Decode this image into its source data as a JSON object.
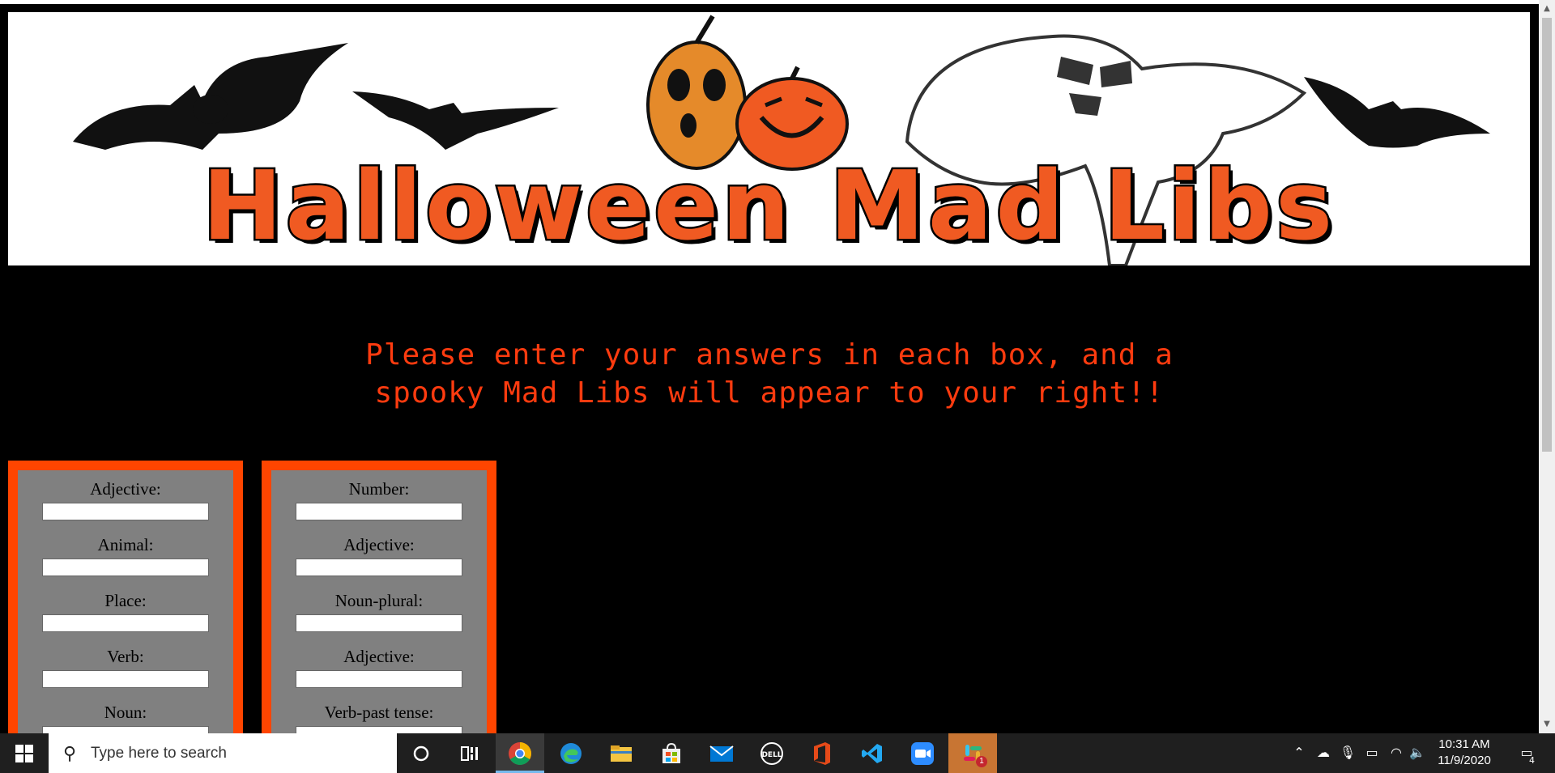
{
  "banner": {
    "title": "Halloween Mad Libs",
    "colors": {
      "title_fill": "#f05a22",
      "title_outline": "#000000",
      "pumpkin_orange": "#e58a2a"
    }
  },
  "instructions": {
    "line1": "Please enter your answers in each box, and a",
    "line2": "spooky Mad Libs will appear to your right!!"
  },
  "form": {
    "left": [
      {
        "label": "Adjective:",
        "value": ""
      },
      {
        "label": "Animal:",
        "value": ""
      },
      {
        "label": "Place:",
        "value": ""
      },
      {
        "label": "Verb:",
        "value": ""
      },
      {
        "label": "Noun:",
        "value": ""
      }
    ],
    "right": [
      {
        "label": "Number:",
        "value": ""
      },
      {
        "label": "Adjective:",
        "value": ""
      },
      {
        "label": "Noun-plural:",
        "value": ""
      },
      {
        "label": "Adjective:",
        "value": ""
      },
      {
        "label": "Verb-past tense:",
        "value": ""
      }
    ],
    "colors": {
      "panel_border": "#ff4500",
      "panel_bg": "#808080"
    }
  },
  "taskbar": {
    "search_placeholder": "Type here to search",
    "apps": [
      "cortana-icon",
      "task-view-icon",
      "chrome-icon",
      "edge-icon",
      "file-explorer-icon",
      "store-icon",
      "mail-icon",
      "dell-icon",
      "office-icon",
      "vscode-icon",
      "zoom-icon",
      "slack-icon"
    ],
    "slack_badge": "1",
    "time": "10:31 AM",
    "date": "11/9/2020",
    "notification_count": "4",
    "dell_label": "DELL"
  }
}
